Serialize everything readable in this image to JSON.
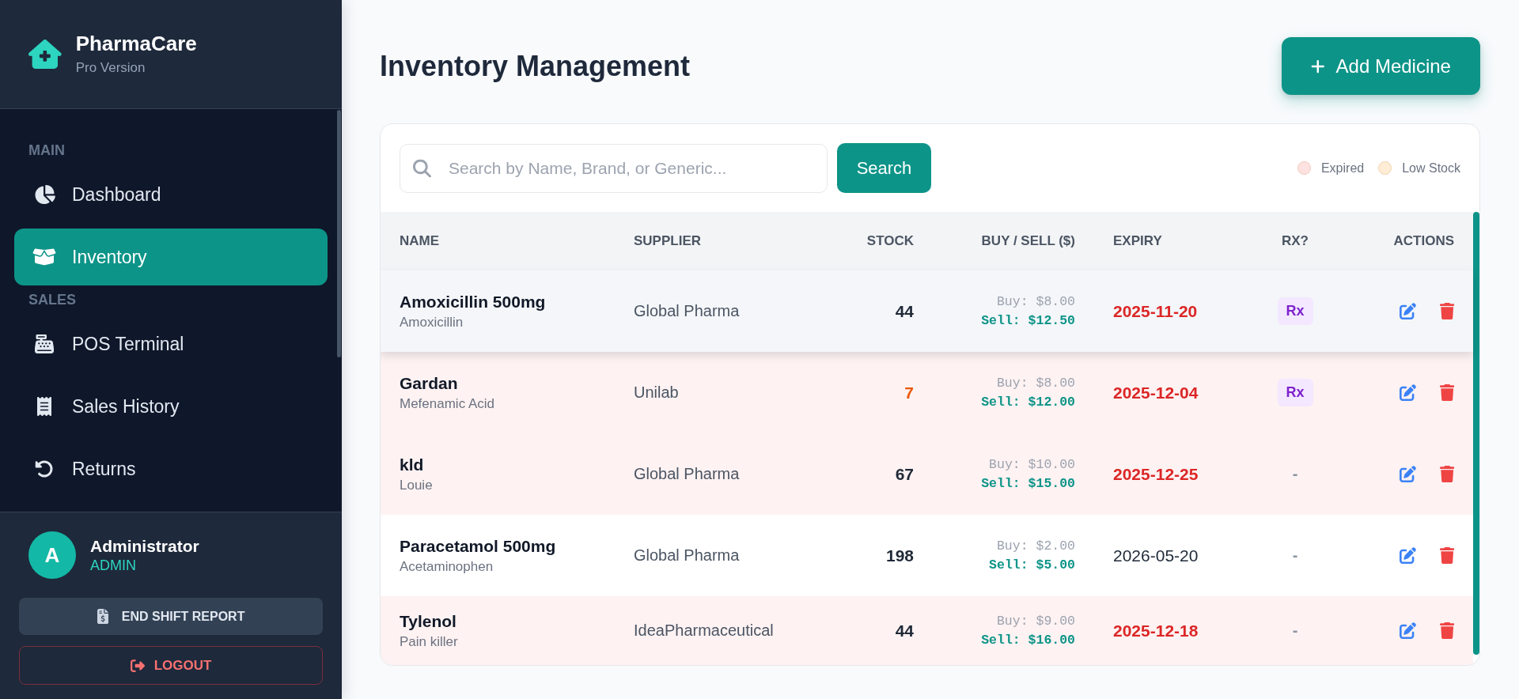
{
  "sidebar": {
    "brand": {
      "name": "PharmaCare",
      "subtitle": "Pro Version"
    },
    "sections": [
      {
        "label": "MAIN",
        "items": [
          {
            "label": "Dashboard",
            "selected": false
          },
          {
            "label": "Inventory",
            "selected": true
          }
        ]
      },
      {
        "label": "SALES",
        "items": [
          {
            "label": "POS Terminal",
            "selected": false
          },
          {
            "label": "Sales History",
            "selected": false
          },
          {
            "label": "Returns",
            "selected": false
          }
        ]
      }
    ],
    "user": {
      "initial": "A",
      "name": "Administrator",
      "role": "ADMIN"
    },
    "buttons": [
      {
        "label": "END SHIFT REPORT",
        "kind": "secondary"
      },
      {
        "label": "LOGOUT",
        "kind": "danger"
      }
    ]
  },
  "page": {
    "title": "Inventory Management",
    "add_button": "Add Medicine"
  },
  "search": {
    "placeholder": "Search by Name, Brand, or Generic...",
    "button": "Search"
  },
  "legend": [
    {
      "label": "Expired",
      "color": "#fee2e2"
    },
    {
      "label": "Low Stock",
      "color": "#ffedd5"
    }
  ],
  "table": {
    "columns": [
      "NAME",
      "SUPPLIER",
      "STOCK",
      "BUY / SELL ($)",
      "EXPIRY",
      "RX?",
      "ACTIONS"
    ],
    "rows": [
      {
        "name": "Amoxicillin 500mg",
        "generic": "Amoxicillin",
        "supplier": "Global Pharma",
        "stock": "44",
        "buy": "Buy: $8.00",
        "sell": "Sell: $12.50",
        "expiry": "2025-11-20",
        "rx": "Rx",
        "rx_required": true,
        "expired": true,
        "low_stock": false,
        "highlighted": true
      },
      {
        "name": "Gardan",
        "generic": "Mefenamic Acid",
        "supplier": "Unilab",
        "stock": "7",
        "buy": "Buy: $8.00",
        "sell": "Sell: $12.00",
        "expiry": "2025-12-04",
        "rx": "Rx",
        "rx_required": true,
        "expired": true,
        "low_stock": true,
        "highlighted": false
      },
      {
        "name": "kld",
        "generic": "Louie",
        "supplier": "Global Pharma",
        "stock": "67",
        "buy": "Buy: $10.00",
        "sell": "Sell: $15.00",
        "expiry": "2025-12-25",
        "rx": "-",
        "rx_required": false,
        "expired": true,
        "low_stock": false,
        "highlighted": false
      },
      {
        "name": "Paracetamol 500mg",
        "generic": "Acetaminophen",
        "supplier": "Global Pharma",
        "stock": "198",
        "buy": "Buy: $2.00",
        "sell": "Sell: $5.00",
        "expiry": "2026-05-20",
        "rx": "-",
        "rx_required": false,
        "expired": false,
        "low_stock": false,
        "highlighted": false
      },
      {
        "name": "Tylenol",
        "generic": "Pain killer",
        "supplier": "IdeaPharmaceutical",
        "stock": "44",
        "buy": "Buy: $9.00",
        "sell": "Sell: $16.00",
        "expiry": "2025-12-18",
        "rx": "-",
        "rx_required": false,
        "expired": true,
        "low_stock": false,
        "highlighted": false
      }
    ]
  }
}
